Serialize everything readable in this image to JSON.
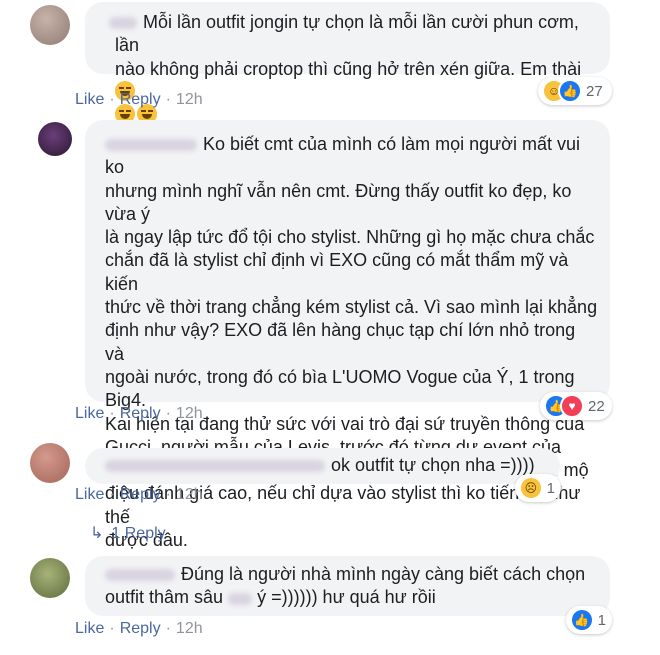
{
  "comments": [
    {
      "text": "Mỗi lần outfit jongin tự chọn là mỗi lần cười phun cơm, lần\nnào không phải croptop thì cũng hở trên xén giữa. Em thài",
      "like": "Like",
      "reply": "Reply",
      "time": "12h",
      "reaction_count": "27",
      "reaction_icons": [
        "haha-icon",
        "like-icon"
      ]
    },
    {
      "text": "Ko biết cmt của mình có làm mọi người mất vui ko\nnhưng mình nghĩ vẫn nên cmt. Đừng thấy outfit ko đẹp, ko vừa ý\nlà ngay lập tức đổ tội cho stylist. Những gì họ mặc chưa chắc\nchắn đã là stylist chỉ định vì EXO cũng có mắt thẩm mỹ và kiến\nthức về thời trang chẳng kém stylist cả. Vì sao mình lại khẳng\nđịnh như vậy? EXO đã lên hàng chục tạp chí lớn nhỏ trong và\nngoài nước, trong đó có bìa L'UOMO Vogue của Ý, 1 trong Big4.\nKai hiện tại đang thử sức với vai trò đại sứ truyền thông của\nGucci, người mẫu của Levis, trước đó từng dự event của\nBurberry, Ralph Laurent,... chứng tỏ anh ấy đã được giới mộ\nđiệu đánh giá cao, nếu chỉ dựa vào stylist thì ko tiến xa như thế\nđược đâu.",
      "like": "Like",
      "reply": "Reply",
      "time": "12h",
      "reaction_count": "22",
      "reaction_icons": [
        "like-icon",
        "love-icon"
      ]
    },
    {
      "text": "ok outfit tự chọn nha =))))",
      "like": "Like",
      "reply": "Reply",
      "time": "12h",
      "reaction_count": "1",
      "reaction_icons": [
        "sad-icon"
      ],
      "replies_link": "1 Reply"
    },
    {
      "text_before": "Đúng là người nhà mình ngày càng biết cách chọn\noutfit thâm sâu ",
      "text_after": " ý =)))))) hư quá hư rồii",
      "like": "Like",
      "reply": "Reply",
      "time": "12h",
      "reaction_count": "1",
      "reaction_icons": [
        "like-icon"
      ]
    }
  ],
  "separator": "·",
  "colors": {
    "bubble": "#f2f3f5",
    "link": "#4b67a1",
    "meta": "#90949c",
    "like": "#1877f2",
    "love": "#f33e58",
    "haha": "#f7c33c"
  }
}
